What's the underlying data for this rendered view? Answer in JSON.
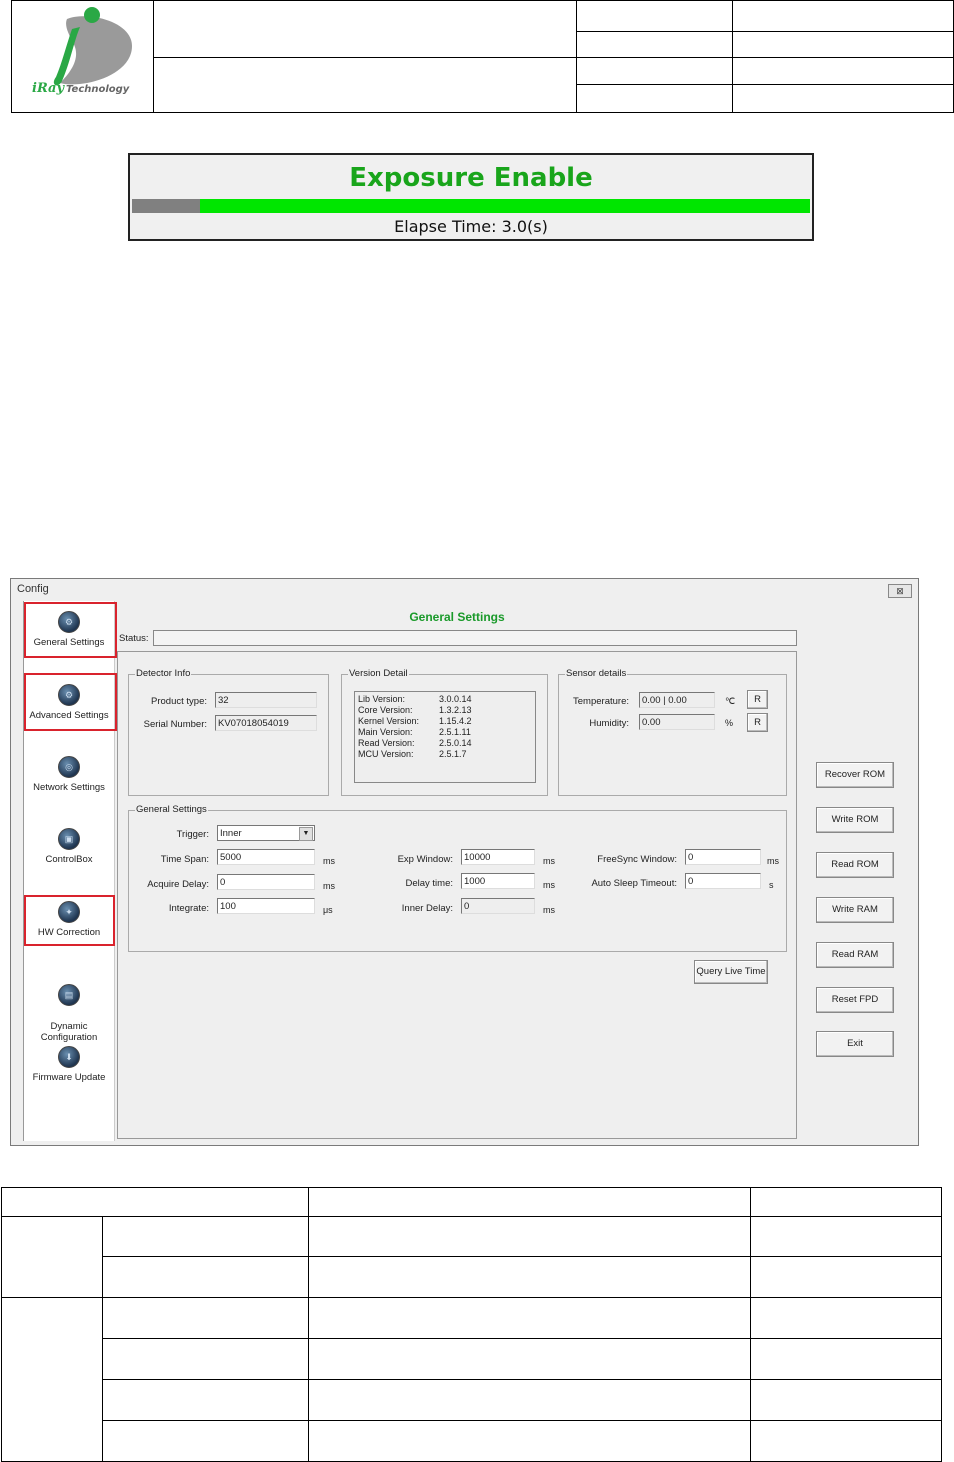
{
  "header": {
    "logo_text": "iRayTechnology"
  },
  "exposure": {
    "title": "Exposure Enable",
    "progress": 0.1,
    "elapse": "Elapse Time: 3.0(s)"
  },
  "window": {
    "title": "Config",
    "close_glyph": "⊠",
    "page_title": "General Settings",
    "status_label": "Status:",
    "status_value": "",
    "nav": [
      {
        "label": "General Settings",
        "icon": "general-settings-icon"
      },
      {
        "label": "Advanced Settings",
        "icon": "advanced-settings-icon"
      },
      {
        "label": "Network Settings",
        "icon": "network-settings-icon"
      },
      {
        "label": "ControlBox",
        "icon": "controlbox-icon"
      },
      {
        "label": "HW Correction",
        "icon": "hw-correction-icon"
      },
      {
        "label": "Dynamic\nConfiguration",
        "icon": "dynamic-configuration-icon"
      },
      {
        "label": "Firmware Update",
        "icon": "firmware-update-icon"
      }
    ],
    "detector_info": {
      "legend": "Detector Info",
      "product_type_label": "Product type:",
      "product_type": "32",
      "serial_label": "Serial Number:",
      "serial": "KV07018054019"
    },
    "version_detail": {
      "legend": "Version Detail",
      "rows": [
        {
          "label": "Lib Version:",
          "value": "3.0.0.14"
        },
        {
          "label": "Core Version:",
          "value": "1.3.2.13"
        },
        {
          "label": "Kernel Version:",
          "value": "1.15.4.2"
        },
        {
          "label": "Main Version:",
          "value": "2.5.1.11"
        },
        {
          "label": "Read Version:",
          "value": "2.5.0.14"
        },
        {
          "label": "MCU Version:",
          "value": "2.5.1.7"
        }
      ]
    },
    "sensor": {
      "legend": "Sensor details",
      "temp_label": "Temperature:",
      "temp": "0.00 | 0.00",
      "temp_unit": "℃",
      "hum_label": "Humidity:",
      "hum": "0.00",
      "hum_unit": "%",
      "r_label": "R"
    },
    "general": {
      "legend": "General Settings",
      "trigger_label": "Trigger:",
      "trigger": "Inner",
      "time_span_label": "Time Span:",
      "time_span": "5000",
      "acq_delay_label": "Acquire Delay:",
      "acq_delay": "0",
      "integrate_label": "Integrate:",
      "integrate": "100",
      "exp_window_label": "Exp Window:",
      "exp_window": "10000",
      "delay_time_label": "Delay time:",
      "delay_time": "1000",
      "inner_delay_label": "Inner Delay:",
      "inner_delay": "0",
      "freesync_label": "FreeSync Window:",
      "freesync": "0",
      "auto_sleep_label": "Auto Sleep Timeout:",
      "auto_sleep": "0",
      "unit_ms": "ms",
      "unit_us": "μs",
      "unit_s": "s"
    },
    "query_button": "Query Live Time",
    "right_buttons": [
      "Recover ROM",
      "Write ROM",
      "Read ROM",
      "Write RAM",
      "Read RAM",
      "Reset FPD",
      "Exit"
    ]
  }
}
